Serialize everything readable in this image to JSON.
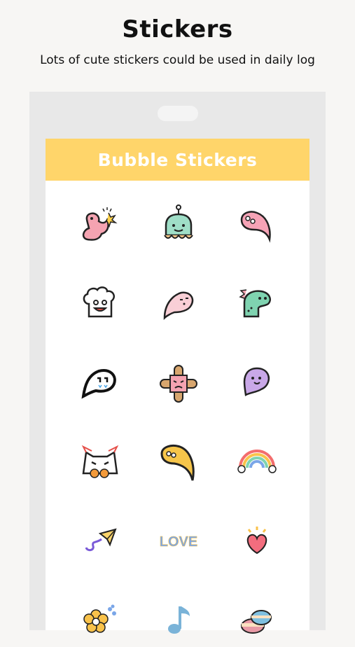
{
  "page": {
    "title": "Stickers",
    "subtitle": "Lots of cute stickers could be used in daily log"
  },
  "panel": {
    "title": "Bubble Stickers"
  },
  "stickers": [
    {
      "icon": "pink-dino-icon"
    },
    {
      "icon": "mint-jellyfish-icon"
    },
    {
      "icon": "pink-bubble-icon"
    },
    {
      "icon": "chef-hat-icon"
    },
    {
      "icon": "pink-ghost-bubble-icon"
    },
    {
      "icon": "green-dino-icon"
    },
    {
      "icon": "black-bubble-icon"
    },
    {
      "icon": "bandaged-face-icon"
    },
    {
      "icon": "purple-bubble-icon"
    },
    {
      "icon": "angry-cat-icon"
    },
    {
      "icon": "yellow-bubble-icon"
    },
    {
      "icon": "rainbow-icon"
    },
    {
      "icon": "paper-plane-icon"
    },
    {
      "icon": "love-text-icon",
      "text": "LOVE"
    },
    {
      "icon": "heart-icon"
    },
    {
      "icon": "yellow-flower-icon"
    },
    {
      "icon": "music-note-icon"
    },
    {
      "icon": "macaron-icon"
    }
  ],
  "colors": {
    "header": "#ffd56a",
    "phone_frame": "#e8e8e8",
    "background": "#f7f6f4"
  }
}
